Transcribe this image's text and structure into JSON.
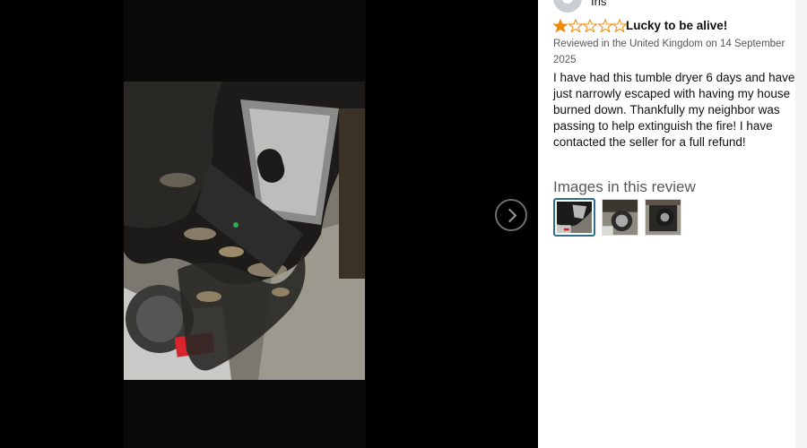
{
  "reviewer": {
    "name": "Iris"
  },
  "review": {
    "rating": 1,
    "max_rating": 5,
    "star_color": "#f08804",
    "title": "Lucky to be alive!",
    "meta": "Reviewed in the United Kingdom on 14 September 2025",
    "body": "I have had this tumble dryer 6 days and have just narrowly escaped with having my house burned down. Thankfully my neighbor was passing to help extinguish the fire! I have contacted the seller for a full refund!"
  },
  "images_section": {
    "heading": "Images in this review",
    "selected_index": 0,
    "thumbnail_count": 3
  },
  "viewer": {
    "next_icon": "chevron-right-icon"
  }
}
